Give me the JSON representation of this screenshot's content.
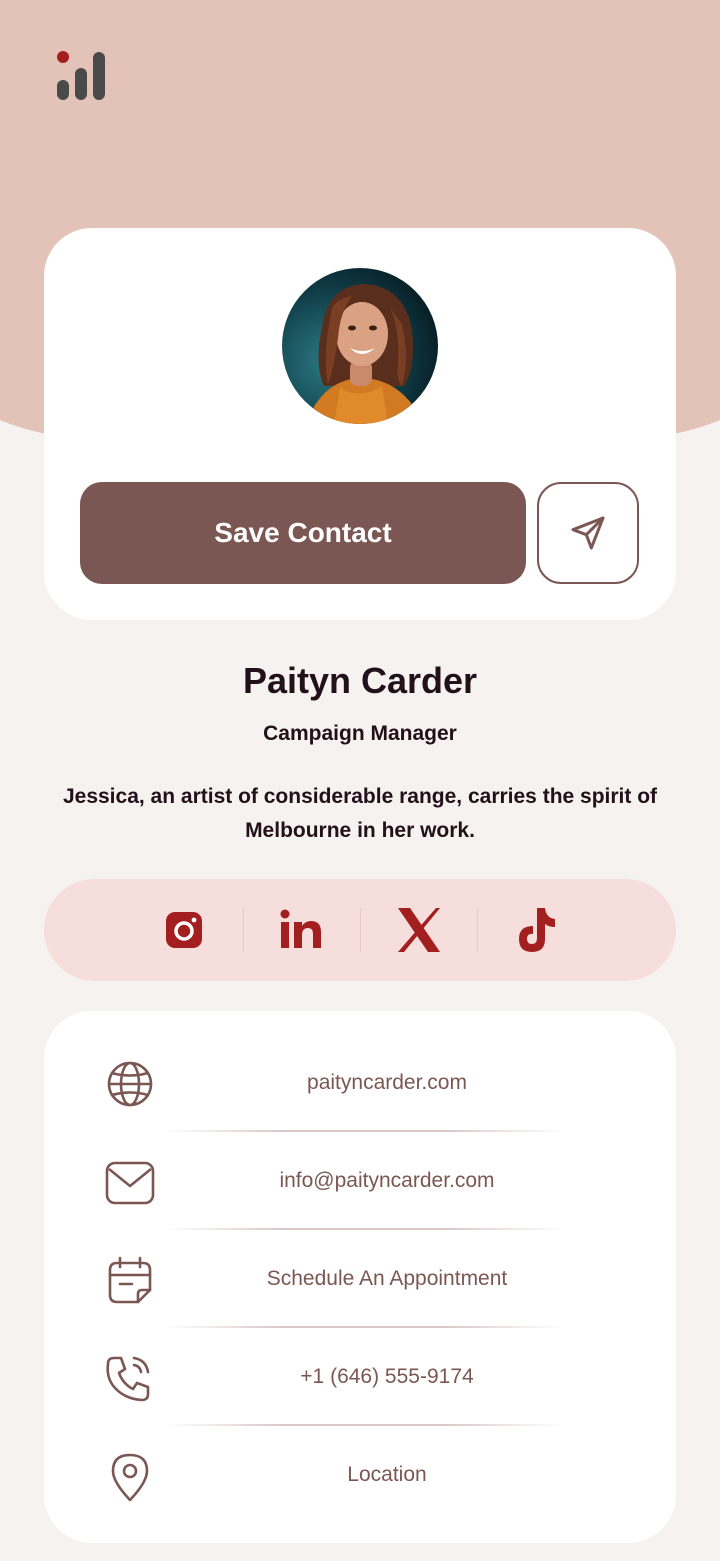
{
  "colors": {
    "hero_bg": "#e3c3b8",
    "page_bg": "#f6f2ef",
    "accent": "#7b5753",
    "brand_red": "#a31f1f",
    "social_bg": "#f5dedb",
    "text_dark": "#22101a"
  },
  "header": {
    "logo": "bar-chart-logo-icon"
  },
  "profile": {
    "avatar": "profile-photo",
    "save_label": "Save Contact",
    "share_icon": "paper-plane-icon"
  },
  "person": {
    "name": "Paityn Carder",
    "title": "Campaign Manager",
    "bio": "Jessica, an artist of considerable range, carries the spirit of Melbourne in her work."
  },
  "social": [
    {
      "icon": "instagram-icon"
    },
    {
      "icon": "linkedin-icon"
    },
    {
      "icon": "x-twitter-icon"
    },
    {
      "icon": "tiktok-icon"
    }
  ],
  "contacts": [
    {
      "icon": "globe-icon",
      "label": "paityncarder.com"
    },
    {
      "icon": "mail-icon",
      "label": "info@paityncarder.com"
    },
    {
      "icon": "calendar-icon",
      "label": "Schedule An Appointment"
    },
    {
      "icon": "phone-icon",
      "label": "+1 (646) 555-9174"
    },
    {
      "icon": "location-pin-icon",
      "label": "Location"
    }
  ]
}
